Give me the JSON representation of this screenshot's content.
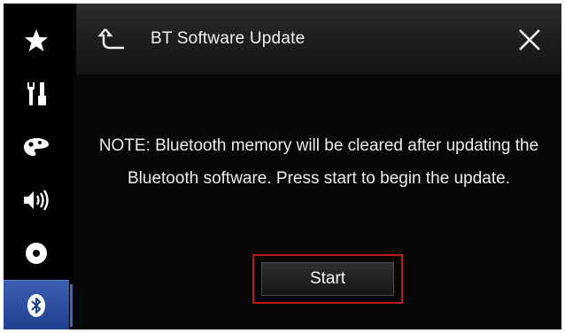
{
  "sidebar": {
    "items": [
      {
        "icon": "star-icon"
      },
      {
        "icon": "settings-tools-icon"
      },
      {
        "icon": "theme-palette-icon"
      },
      {
        "icon": "audio-speaker-icon"
      },
      {
        "icon": "disc-icon"
      },
      {
        "icon": "bluetooth-icon",
        "active": true
      }
    ]
  },
  "header": {
    "title": "BT Software Update"
  },
  "content": {
    "note": "NOTE: Bluetooth memory will be cleared after updating the Bluetooth software. Press start to begin the update."
  },
  "actions": {
    "start_label": "Start"
  },
  "colors": {
    "accent_blue": "#2f52a4",
    "focus_red": "#b71b1b"
  }
}
